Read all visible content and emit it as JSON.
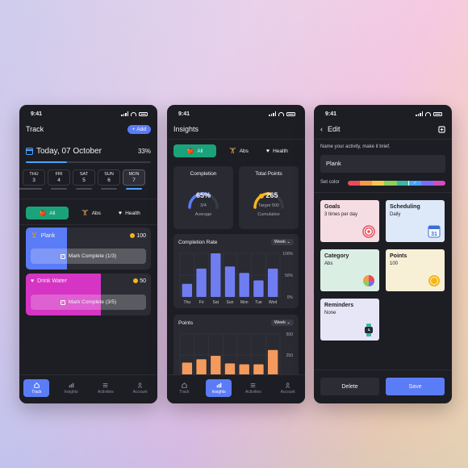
{
  "status_time": "9:41",
  "screen1": {
    "title": "Track",
    "add_label": "Add",
    "date": "Today, 07 October",
    "percent": "33%",
    "progress": 0.33,
    "days": [
      {
        "name": "THU",
        "num": "3"
      },
      {
        "name": "FRI",
        "num": "4"
      },
      {
        "name": "SAT",
        "num": "5"
      },
      {
        "name": "SUN",
        "num": "6"
      },
      {
        "name": "MON",
        "num": "7"
      }
    ],
    "filters": [
      "All",
      "Abs",
      "Health"
    ],
    "activities": [
      {
        "name": "Plank",
        "points": "100",
        "button": "Mark Complete (1/3)",
        "color": "#5b7cf7",
        "fill": 0.33
      },
      {
        "name": "Drink Water",
        "points": "50",
        "button": "Mark Complete (3/5)",
        "color": "#d534c4",
        "fill": 0.6
      }
    ]
  },
  "screen2": {
    "title": "Insights",
    "filters": [
      "All",
      "Abs",
      "Health"
    ],
    "completion": {
      "label": "Completion",
      "value": "65%",
      "sub": "3/4",
      "foot": "Average",
      "fraction": 0.65
    },
    "total_points": {
      "label": "Total Points",
      "value": "265",
      "sub": "Target 500",
      "foot": "Cumulative",
      "fraction": 0.53
    },
    "week_label": "Week"
  },
  "chart_data": [
    {
      "type": "bar",
      "title": "Completion Rate",
      "categories": [
        "Thu",
        "Fri",
        "Sat",
        "Sun",
        "Mon",
        "Tue",
        "Wed"
      ],
      "values": [
        30,
        65,
        100,
        70,
        55,
        38,
        65
      ],
      "yticks": [
        "100%",
        "50%",
        "0%"
      ],
      "ylim": [
        0,
        100
      ]
    },
    {
      "type": "bar",
      "title": "Points",
      "categories": [
        "Thu",
        "Fri",
        "Sat",
        "Sun",
        "Mon",
        "Tue",
        "Wed"
      ],
      "values": [
        160,
        200,
        240,
        150,
        140,
        140,
        310
      ],
      "yticks": [
        "500",
        "250",
        "0"
      ],
      "ylim": [
        0,
        500
      ]
    }
  ],
  "screen3": {
    "title": "Edit",
    "prompt": "Name your activity, make it brief.",
    "name_value": "Plank",
    "set_color_label": "Set color",
    "palette": [
      "#e94b5a",
      "#f39a4a",
      "#f5c84c",
      "#8ccf5a",
      "#39b8a6",
      "#4aa3ff",
      "#7a6cf2",
      "#d54bc0"
    ],
    "tiles": [
      {
        "title": "Goals",
        "sub": "3 times per day",
        "icon": "target-icon",
        "bg": "#f6dde3"
      },
      {
        "title": "Scheduling",
        "sub": "Daily",
        "icon": "calendar-icon",
        "bg": "#dde8f8",
        "icon_text": "31"
      },
      {
        "title": "Category",
        "sub": "Abs",
        "icon": "color-wheel-icon",
        "bg": "#dbeee4"
      },
      {
        "title": "Points",
        "sub": "100",
        "icon": "coin-icon",
        "bg": "#f7f0d6"
      },
      {
        "title": "Reminders",
        "sub": "None",
        "icon": "watch-icon",
        "bg": "#e6e6f6"
      }
    ],
    "delete_label": "Delete",
    "save_label": "Save"
  },
  "tabs": [
    "Track",
    "Insights",
    "Activities",
    "Account"
  ]
}
